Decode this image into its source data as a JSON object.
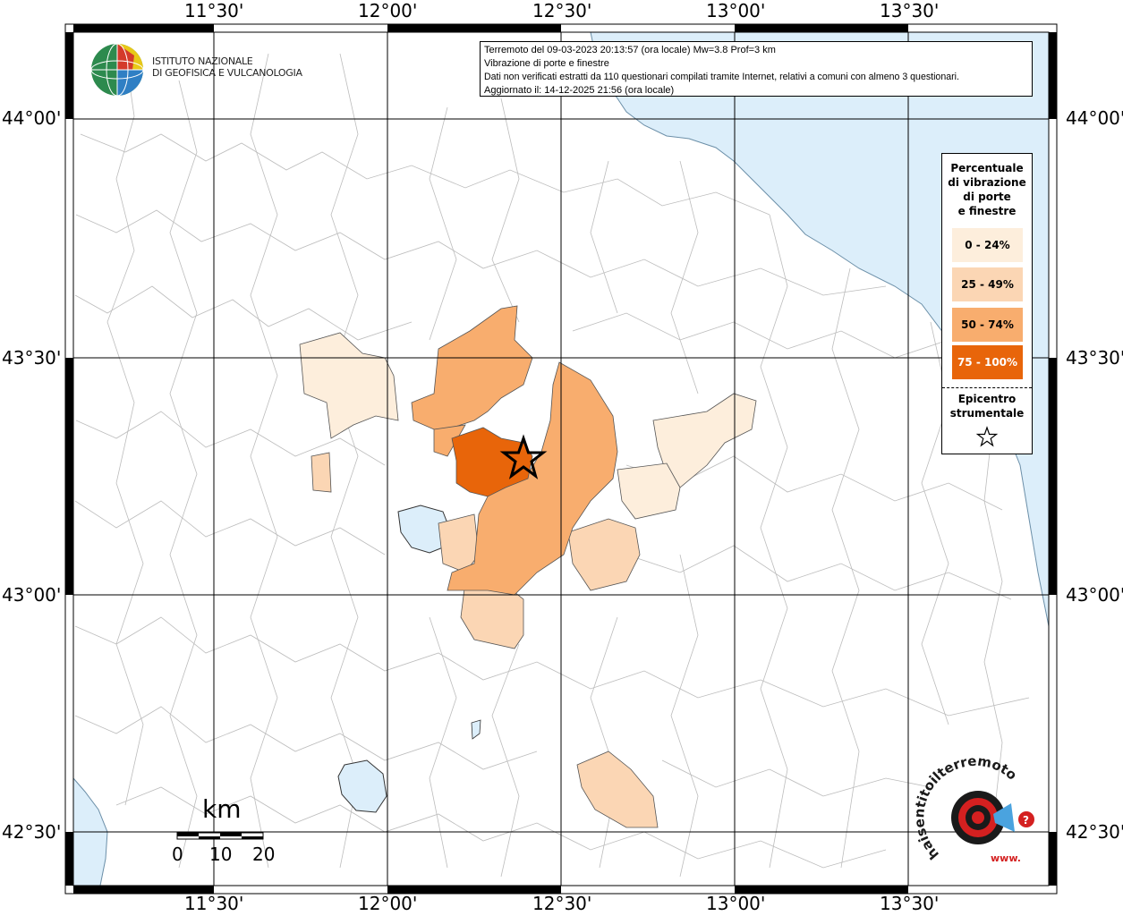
{
  "axes": {
    "lon_labels": [
      "11°30'",
      "12°00'",
      "12°30'",
      "13°00'",
      "13°30'"
    ],
    "lat_labels": [
      "44°00'",
      "43°30'",
      "43°00'",
      "42°30'"
    ]
  },
  "info": {
    "line1": "Terremoto del 09-03-2023 20:13:57 (ora locale) Mw=3.8 Prof=3 km",
    "line2": "Vibrazione di porte e finestre",
    "line3": "Dati non verificati estratti da 110 questionari compilati tramite Internet, relativi a comuni con almeno 3 questionari.",
    "line4": "Aggiornato il: 14-12-2025 21:56 (ora locale)"
  },
  "ingv_logo": {
    "line1": "ISTITUTO NAZIONALE",
    "line2": "DI GEOFISICA E VULCANOLOGIA"
  },
  "legend": {
    "title": [
      "Percentuale",
      "di vibrazione",
      "di porte",
      "e finestre"
    ],
    "classes": [
      {
        "label": "0 - 24%",
        "color": "#fdeedc"
      },
      {
        "label": "25 - 49%",
        "color": "#fbd6b4"
      },
      {
        "label": "50 - 74%",
        "color": "#f8ad6e"
      },
      {
        "label": "75 - 100%",
        "color": "#e8650a"
      }
    ],
    "epicenter_label": [
      "Epicentro",
      "strumentale"
    ]
  },
  "scale_bar": {
    "unit": "km",
    "ticks": [
      "0",
      "10",
      "20"
    ]
  },
  "hsit_logo": {
    "text": "haisentitoilterremoto.it",
    "url_text": "www."
  },
  "colors": {
    "sea": "#dceefa",
    "boundary": "#aaaaaa",
    "grid": "#000000"
  }
}
